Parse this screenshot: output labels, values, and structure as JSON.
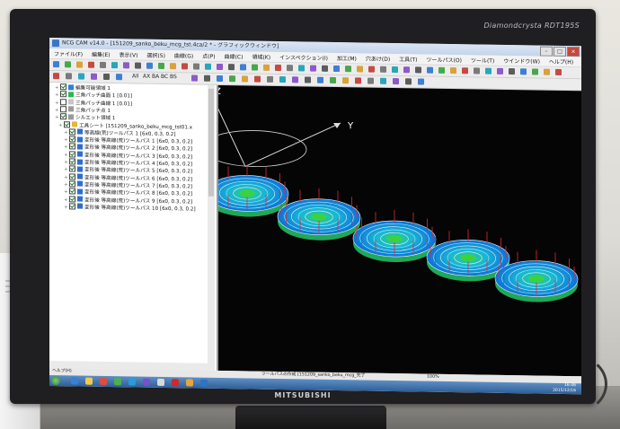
{
  "window": {
    "title": "NCG CAM v14.0 - [151209_sanko_beku_mcg_tst.4ca/2 * - グラフィックウィンドウ]"
  },
  "monitor": {
    "model": "Diamondcrysta RDT195S",
    "brand": "MITSUBISHI"
  },
  "menu": [
    "ファイル(F)",
    "編集(E)",
    "表示(V)",
    "選択(S)",
    "曲線(G)",
    "点(P)",
    "曲線(C)",
    "領域(K)",
    "インスペクション(I)",
    "加工(M)",
    "穴あけ(D)",
    "工具(T)",
    "ツールパス(O)",
    "ツール(T)",
    "ウインドウ(W)",
    "ヘルプ(H)"
  ],
  "toolbar": {
    "labels": [
      "All",
      "AX",
      "BA",
      "BC",
      "BS"
    ]
  },
  "tree": {
    "items": [
      {
        "label": "編集可能領域 1",
        "checked": true
      },
      {
        "label": "三角パッチ曲面 1 [0.01]",
        "checked": true
      },
      {
        "label": "三角パッチ曲線 1 [0.01]",
        "checked": false
      },
      {
        "label": "三角パッチ点 1",
        "checked": false
      },
      {
        "label": "シルエット領域 1",
        "checked": true
      },
      {
        "label": "工具シート [151209_sanko_beku_mcg_tst01.x",
        "checked": true
      },
      {
        "label": "等高線(荒)ツールパス 1 [6x0, 0.3, 0.2]",
        "checked": true
      },
      {
        "label": "変形後 等高線(荒)ツールパス 1 [6x0, 0.3, 0.2]",
        "checked": true
      },
      {
        "label": "変形後 等高線(荒)ツールパス 2 [6x0, 0.3, 0.2]",
        "checked": true
      },
      {
        "label": "変形後 等高線(荒)ツールパス 3 [6x0, 0.3, 0.2]",
        "checked": true
      },
      {
        "label": "変形後 等高線(荒)ツールパス 4 [6x0, 0.3, 0.2]",
        "checked": true
      },
      {
        "label": "変形後 等高線(荒)ツールパス 5 [6x0, 0.3, 0.2]",
        "checked": true
      },
      {
        "label": "変形後 等高線(荒)ツールパス 6 [6x0, 0.3, 0.2]",
        "checked": true
      },
      {
        "label": "変形後 等高線(荒)ツールパス 7 [6x0, 0.3, 0.2]",
        "checked": true
      },
      {
        "label": "変形後 等高線(荒)ツールパス 8 [6x0, 0.3, 0.2]",
        "checked": true
      },
      {
        "label": "変形後 等高線(荒)ツールパス 9 [6x0, 0.3, 0.2]",
        "checked": true
      },
      {
        "label": "変形後 等高線(荒)ツールパス 10 [6x0, 0.3, 0.2]",
        "checked": true
      }
    ]
  },
  "viewport": {
    "axis_z": "Z",
    "axis_y": "Y"
  },
  "statusbar": {
    "left": "ヘルプ(H)",
    "middle": "ツールパスの作成 [151209_sanko_beku_mcg_完了",
    "right": "100%"
  },
  "taskbar": {
    "time": "16:46",
    "date": "2015/12/16"
  },
  "colors": {
    "accent": "#2f5f97",
    "toolpath_cyan": "#19d6e0",
    "toolpath_red": "#e0283a",
    "surface_green": "#3cd23c"
  }
}
